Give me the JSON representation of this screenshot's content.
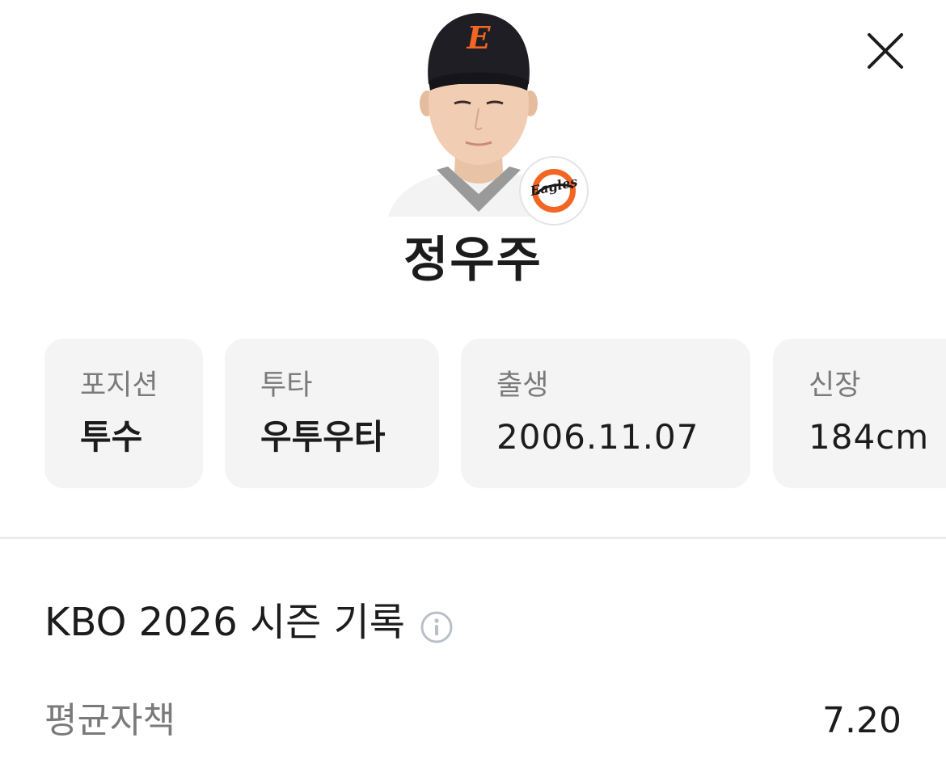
{
  "header": {
    "close_icon": "close-icon"
  },
  "player": {
    "name": "정우주",
    "photo_icon": "player-photo",
    "team_logo_text": "Eagles",
    "cap_letter": "E"
  },
  "info_cards": [
    {
      "label": "포지션",
      "value": "투수"
    },
    {
      "label": "투타",
      "value": "우투우타"
    },
    {
      "label": "출생",
      "value": "2006.11.07"
    },
    {
      "label": "신장",
      "value": "184cm"
    }
  ],
  "season": {
    "title": "KBO 2026 시즌 기록",
    "info_icon": "info-icon"
  },
  "stats": [
    {
      "label": "평균자책",
      "value": "7.20"
    }
  ],
  "colors": {
    "card_bg": "#f4f4f4",
    "label_gray": "#7a7a7a",
    "text_dark": "#1c1c1c",
    "team_orange": "#f26522"
  }
}
